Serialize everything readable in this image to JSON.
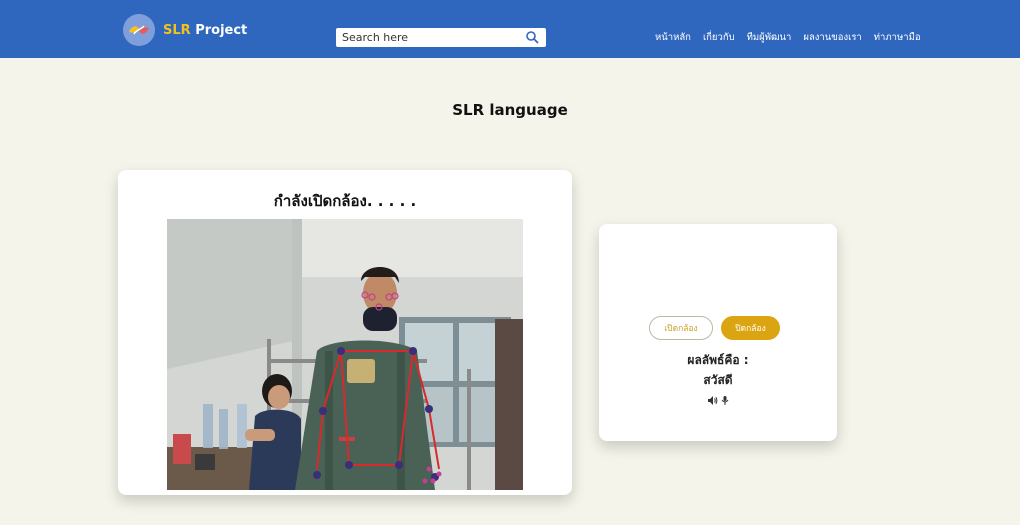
{
  "header": {
    "brand_accent": "SLR",
    "brand_rest": " Project",
    "search_placeholder": "Search here",
    "nav": [
      "หน้าหลัก",
      "เกี่ยวกับ",
      "ทีมผู้พัฒนา",
      "ผลงานของเรา",
      "ท่าภาษามือ"
    ]
  },
  "page": {
    "title": "SLR language"
  },
  "camera": {
    "status": "กำลังเปิดกล้อง. . . . ."
  },
  "controls": {
    "open_label": "เปิดกล้อง",
    "close_label": "ปิดกล้อง"
  },
  "result": {
    "label": "ผลลัพธ์คือ :",
    "value": "สวัสดี"
  },
  "icons": {
    "logo": "hands-logo-icon",
    "search": "search-icon",
    "speaker": "speaker-icon",
    "mic": "microphone-icon"
  },
  "colors": {
    "navbar": "#2f67bf",
    "accent": "#f4c21b",
    "button_close": "#dba512",
    "page_bg": "#f4f4ea"
  }
}
